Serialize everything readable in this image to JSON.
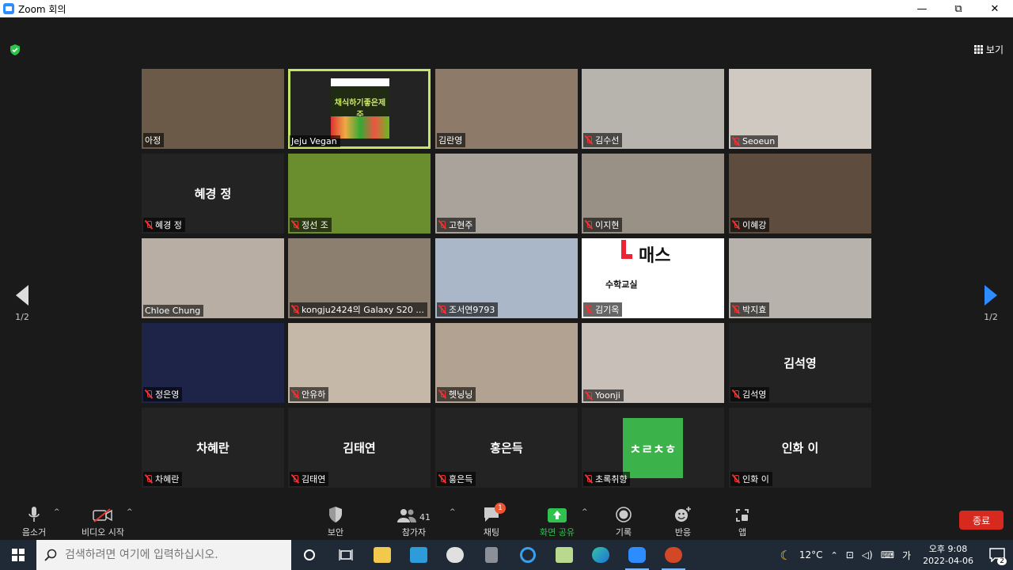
{
  "window": {
    "title": "Zoom 회의",
    "minimize": "—",
    "restore": "⧉",
    "close": "✕"
  },
  "header": {
    "view_label": "보기"
  },
  "pager": {
    "left": "1/2",
    "right": "1/2"
  },
  "participants": [
    {
      "label": "아정",
      "muted": false,
      "kind": "video",
      "bg": "#6b5a48"
    },
    {
      "label": "Jeju Vegan",
      "muted": false,
      "kind": "logo",
      "logo_text": "채식하기좋은제주",
      "bg": "#1f1f1f"
    },
    {
      "label": "김란영",
      "muted": false,
      "kind": "video",
      "bg": "#8d7a69"
    },
    {
      "label": "김수선",
      "muted": true,
      "kind": "video",
      "bg": "#b7b3ad"
    },
    {
      "label": "Seoeun",
      "muted": true,
      "kind": "video",
      "bg": "#cfc9c2"
    },
    {
      "label": "혜경 정",
      "muted": true,
      "kind": "name",
      "display_name": "혜경 정"
    },
    {
      "label": "정선 조",
      "muted": true,
      "kind": "video",
      "bg": "#6a8e2e"
    },
    {
      "label": "고현주",
      "muted": true,
      "kind": "video",
      "bg": "#a9a39b"
    },
    {
      "label": "이지현",
      "muted": true,
      "kind": "video",
      "bg": "#9a9186"
    },
    {
      "label": "이혜강",
      "muted": true,
      "kind": "video",
      "bg": "#5e4d3f"
    },
    {
      "label": "Chloe Chung",
      "muted": false,
      "kind": "video",
      "bg": "#b9aea3"
    },
    {
      "label": "kongju2424의 Galaxy S20 ...",
      "muted": true,
      "kind": "video",
      "bg": "#8c7f70"
    },
    {
      "label": "조서연9793",
      "muted": true,
      "kind": "video",
      "bg": "#aab7c9"
    },
    {
      "label": "김기옥",
      "muted": true,
      "kind": "board",
      "board_big": "매스",
      "board_sub": "수학교실"
    },
    {
      "label": "박지효",
      "muted": true,
      "kind": "video",
      "bg": "#b7b2ab"
    },
    {
      "label": "정은영",
      "muted": true,
      "kind": "video",
      "bg": "#1d2447"
    },
    {
      "label": "안유하",
      "muted": true,
      "kind": "video",
      "bg": "#c5b8a8"
    },
    {
      "label": "헷닝닝",
      "muted": true,
      "kind": "video",
      "bg": "#b2a291"
    },
    {
      "label": "Yoonji",
      "muted": true,
      "kind": "video",
      "bg": "#c8c0b8"
    },
    {
      "label": "김석영",
      "muted": true,
      "kind": "name",
      "display_name": "김석영"
    },
    {
      "label": "차혜란",
      "muted": true,
      "kind": "name",
      "display_name": "차혜란"
    },
    {
      "label": "김태연",
      "muted": true,
      "kind": "name",
      "display_name": "김태연"
    },
    {
      "label": "홍은득",
      "muted": true,
      "kind": "name",
      "display_name": "홍은득"
    },
    {
      "label": "초록취향",
      "muted": true,
      "kind": "greenlogo",
      "logo_text": "ㅊㄹㅊㅎ"
    },
    {
      "label": "인화 이",
      "muted": true,
      "kind": "name",
      "display_name": "인화 이"
    }
  ],
  "toolbar": {
    "mute": "음소거",
    "video": "비디오 시작",
    "security": "보안",
    "participants": "참가자",
    "participants_count": "41",
    "chat": "채팅",
    "chat_badge": "1",
    "share": "화면 공유",
    "record": "기록",
    "reactions": "반응",
    "apps": "앱",
    "end": "종료"
  },
  "taskbar": {
    "search_placeholder": "검색하려면 여기에 입력하십시오.",
    "weather": "12°C",
    "ime": "가",
    "time": "오후 9:08",
    "date": "2022-04-06",
    "notif_count": "2"
  },
  "colors": {
    "accent": "#2d8cff",
    "active_speaker": "#c6e567",
    "end": "#d8291f",
    "share": "#2fc24e"
  }
}
